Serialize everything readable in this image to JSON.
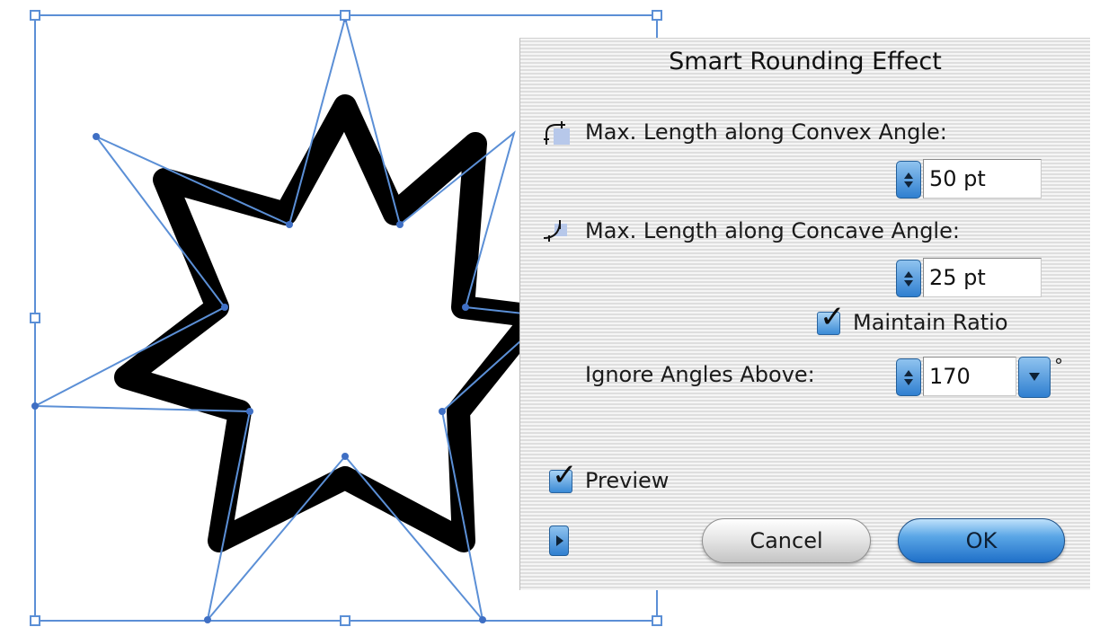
{
  "dialog": {
    "title": "Smart Rounding Effect",
    "convex": {
      "label": "Max. Length along Convex Angle:",
      "value": "50 pt",
      "icon": "convex-angle-icon"
    },
    "concave": {
      "label": "Max. Length along Concave Angle:",
      "value": "25 pt",
      "icon": "concave-angle-icon"
    },
    "maintain_ratio": {
      "label": "Maintain Ratio",
      "checked": true
    },
    "ignore_angles": {
      "label": "Ignore Angles Above:",
      "value": "170",
      "unit": "°"
    },
    "preview": {
      "label": "Preview",
      "checked": true
    },
    "buttons": {
      "cancel": "Cancel",
      "ok": "OK"
    }
  },
  "colors": {
    "selection_blue": "#5b8fd6",
    "aqua_button": "#2f7fd0",
    "star_stroke": "#000000"
  }
}
